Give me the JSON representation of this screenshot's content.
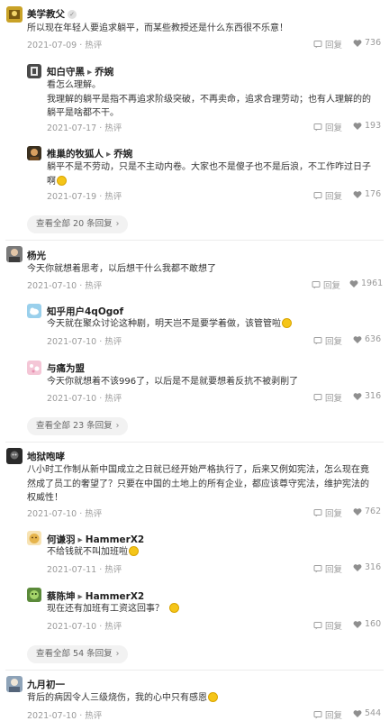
{
  "reply_label": "回复",
  "hot_label": "热评",
  "comments": [
    {
      "user": "美学教父",
      "text": "所以现在年轻人要追求躺平，而某些教授还是什么东西很不乐意！",
      "date": "2021-07-09",
      "likes": "736",
      "replies": [
        {
          "user": "知白守黑",
          "reply_to": "乔婉",
          "text_line1": "看怎么理解。",
          "text_line2": "我理解的躺平是指不再追求阶级突破，不再卖命，追求合理劳动；也有人理解的的",
          "text_line3": "躺平是啥都不干。",
          "date": "2021-07-17",
          "likes": "193"
        },
        {
          "user": "椎巢的牧狐人",
          "reply_to": "乔婉",
          "text_line1": "躺平不是不劳动，只是不主动内卷。大家也不是傻子也不是后浪，不工作咋过日子",
          "text_line2": "啊",
          "date": "2021-07-19",
          "likes": "176"
        }
      ],
      "view_all": "查看全部 20 条回复"
    },
    {
      "user": "杨光",
      "text": "今天你就想着思考，以后想干什么我都不敢想了",
      "date": "2021-07-10",
      "likes": "1961",
      "replies": [
        {
          "user": "知乎用户4qOgof",
          "text": "今天就在聚众讨论这种剧，明天岂不是要学着做，该管管啦",
          "date": "2021-07-10",
          "likes": "636"
        },
        {
          "user": "与痛为盟",
          "text": "今天你就想着不该996了，以后是不是就要想着反抗不被剥削了",
          "date": "2021-07-10",
          "likes": "316"
        }
      ],
      "view_all": "查看全部 23 条回复"
    },
    {
      "user": "地狱咆哮",
      "text_line1": "八小时工作制从新中国成立之日就已经开始严格执行了，后来又例如宪法，怎么现在竟",
      "text_line2": "然成了员工的奢望了？只要在中国的土地上的所有企业，都应该尊守宪法，维护宪法的",
      "text_line3": "权威性！",
      "date": "2021-07-10",
      "likes": "762",
      "replies": [
        {
          "user": "何谦羽",
          "reply_to": "HammerX2",
          "text": "不给钱就不叫加班啦",
          "date": "2021-07-11",
          "likes": "316"
        },
        {
          "user": "蔡陈坤",
          "reply_to": "HammerX2",
          "text": "现在还有加班有工资这回事？",
          "date": "2021-07-10",
          "likes": "160"
        }
      ],
      "view_all": "查看全部 54 条回复"
    },
    {
      "user": "九月初一",
      "text": "背后的病因令人三级烧伤，我的心中只有感恩",
      "date": "2021-07-10",
      "likes": "544"
    }
  ],
  "colors": {
    "text": "#333333",
    "meta": "#9a9a9a",
    "divider": "#ececec",
    "pill": "#f2f2f2"
  }
}
